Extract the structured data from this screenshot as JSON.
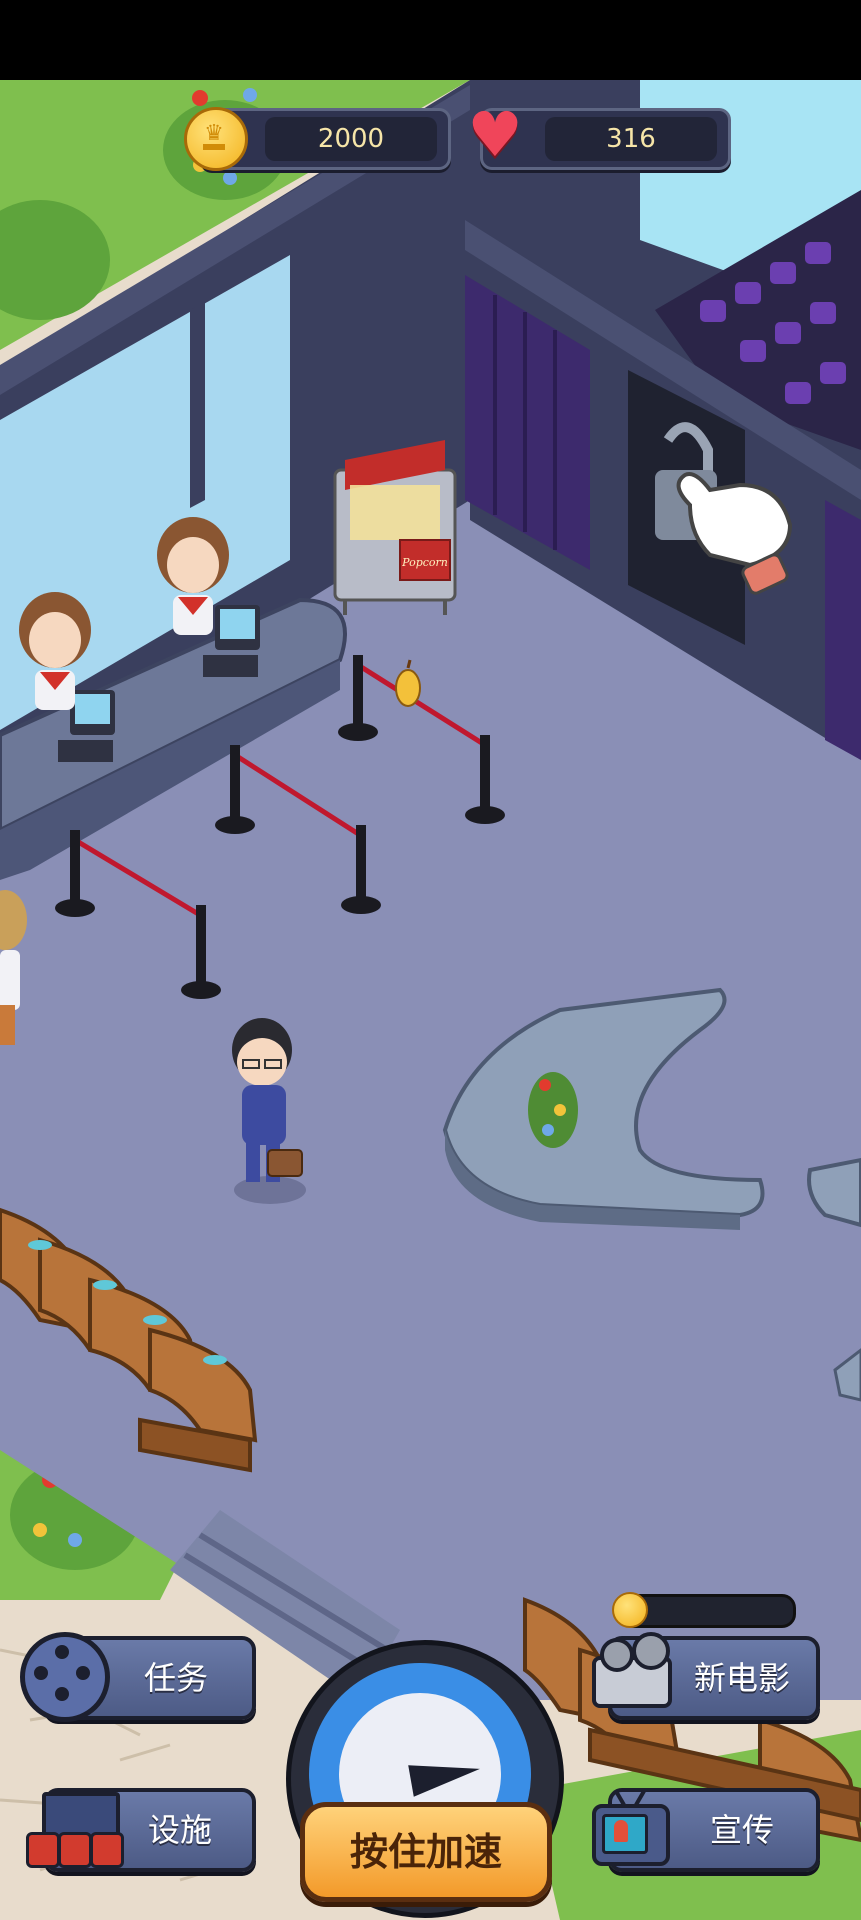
{
  "hud": {
    "coins": "2000",
    "hearts": "316"
  },
  "props": {
    "popcorn_sign": "Popcorn"
  },
  "menu": {
    "tasks_label": "任务",
    "facilities_label": "设施",
    "new_movie_label": "新电影",
    "promote_label": "宣传",
    "speed_button_label": "按住加速"
  },
  "icons": {
    "coin": "coin-icon",
    "heart": "heart-icon",
    "film_reel": "film-reel-icon",
    "cinema_seats": "cinema-seats-icon",
    "projector": "projector-icon",
    "tv": "tv-icon",
    "pointer": "pointer-hand-icon"
  },
  "colors": {
    "floor": "#8a8fb6",
    "wall": "#3a3f5e",
    "curtain": "#3d2a6d",
    "rope": "#c0182e",
    "accent_orange": "#f39a2a"
  }
}
